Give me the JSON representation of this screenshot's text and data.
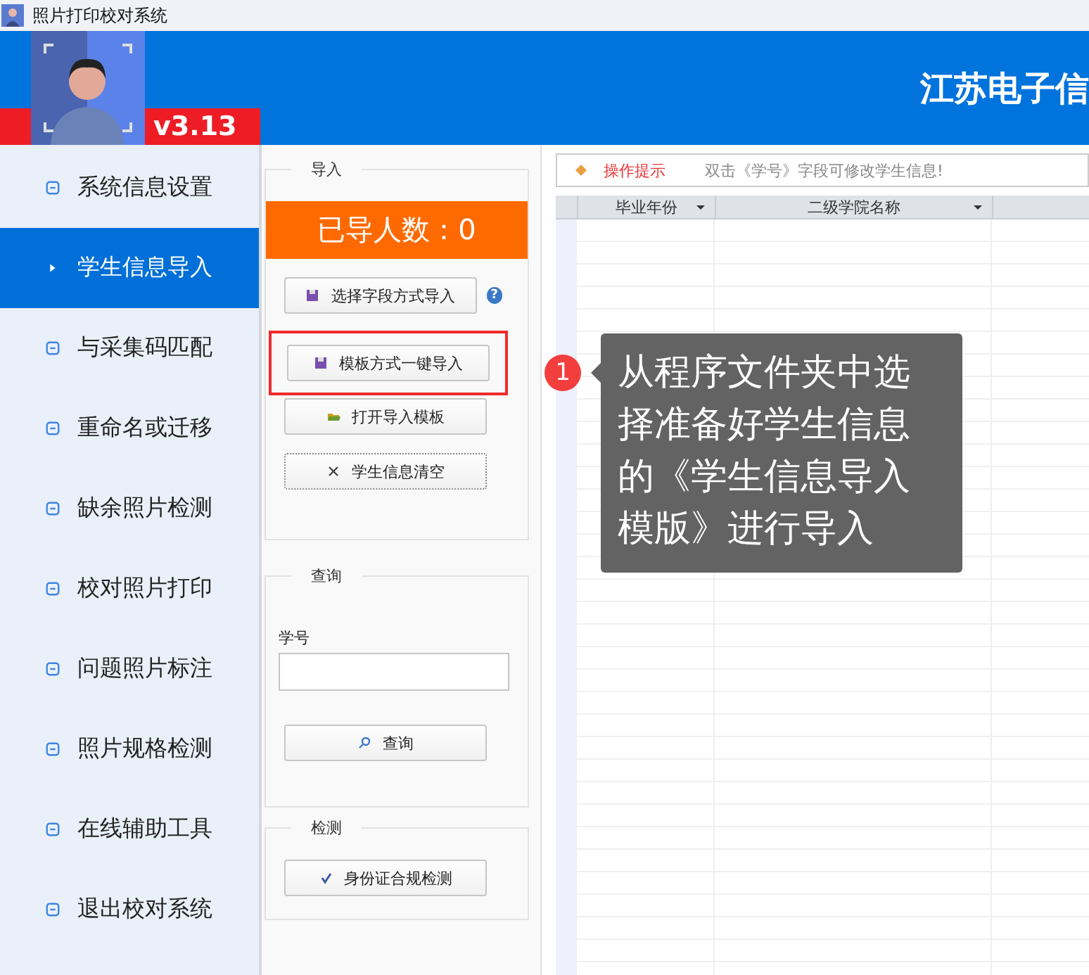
{
  "window": {
    "title": "照片打印校对系统"
  },
  "header": {
    "version": "v3.13",
    "title": "江苏电子信"
  },
  "sidebar": {
    "items": [
      {
        "label": "系统信息设置",
        "selected": false
      },
      {
        "label": "学生信息导入",
        "selected": true
      },
      {
        "label": "与采集码匹配",
        "selected": false
      },
      {
        "label": "重命名或迁移",
        "selected": false
      },
      {
        "label": "缺余照片检测",
        "selected": false
      },
      {
        "label": "校对照片打印",
        "selected": false
      },
      {
        "label": "问题照片标注",
        "selected": false
      },
      {
        "label": "照片规格检测",
        "selected": false
      },
      {
        "label": "在线辅助工具",
        "selected": false
      },
      {
        "label": "退出校对系统",
        "selected": false
      }
    ]
  },
  "import_group": {
    "legend": "导入",
    "count_label": "已导人数：0",
    "buttons": [
      {
        "label": "选择字段方式导入",
        "kind": "import",
        "highlighted": false,
        "help_mark": "?"
      },
      {
        "label": "模板方式一键导入",
        "kind": "import",
        "highlighted": true
      },
      {
        "label": "打开导入模板",
        "kind": "folder",
        "highlighted": false
      },
      {
        "label": "学生信息清空",
        "kind": "clear",
        "highlighted": false
      }
    ]
  },
  "query_group": {
    "legend": "查询",
    "field_label": "学号",
    "button": "查询"
  },
  "detect_group": {
    "legend": "检测",
    "button": "身份证合规检测"
  },
  "hint": {
    "label": "操作提示",
    "text": "双击《学号》字段可修改学生信息!"
  },
  "table": {
    "columns": [
      "毕业年份",
      "二级学院名称"
    ]
  },
  "annotation": {
    "number": "1",
    "text": "从程序文件夹中选择准备好学生信息的《学生信息导入模版》进行导入"
  }
}
